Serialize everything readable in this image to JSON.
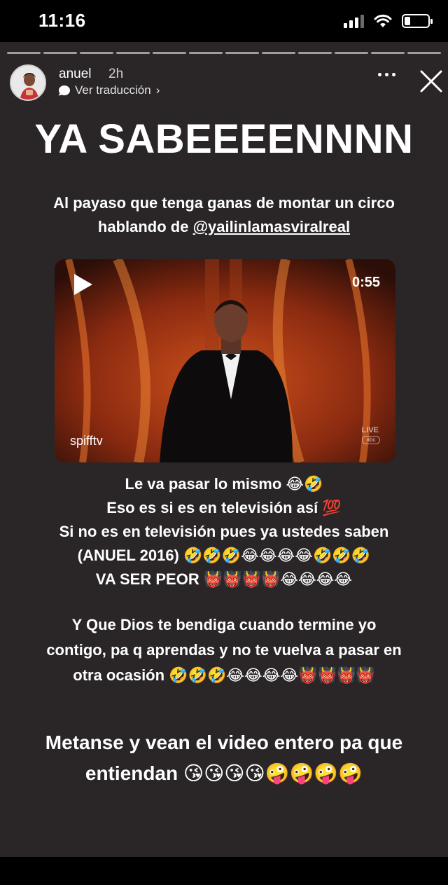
{
  "status_bar": {
    "time": "11:16",
    "signal_bars": 4,
    "signal_bars_filled": 3,
    "battery_level": 0.25
  },
  "story": {
    "background": "#2a2628",
    "progress_segments": 12,
    "header": {
      "username": "anuel",
      "time_ago": "2h",
      "translate_label": "Ver traducción",
      "translate_chevron": "›"
    },
    "title": "YA SABEEEENNNN",
    "intro": {
      "line1": "Al payaso que tenga ganas de montar un circo",
      "line2_prefix": "hablando de ",
      "mention": "@yailinlamasviralreal"
    },
    "video": {
      "duration": "0:55",
      "credit": "spifftv",
      "watermark_live": "LIVE",
      "watermark_network": "abc"
    },
    "block1": {
      "line1": "Le va pasar lo mismo 😂🤣",
      "line2": "Eso es si es en televisión así 💯",
      "line3": "Si no es en televisión pues ya ustedes saben",
      "line4": "(ANUEL 2016) 🤣🤣🤣😂😂😂😂🤣🤣🤣",
      "line5": "VA SER PEOR 👹👹👹👹😂😂😂😂"
    },
    "block2": {
      "line1": "Y Que Dios te bendiga cuando termine yo",
      "line2": "contigo, pa q aprendas y no te vuelva a pasar en",
      "line3": "otra ocasión 🤣🤣🤣😂😂😂😂👹👹👹👹"
    },
    "block3": {
      "line1": "Metanse y vean el video entero pa que",
      "line2": "entiendan 😘😘😘😘🤪🤪🤪🤪"
    }
  },
  "icons": {
    "more": "more-options-icon",
    "close": "close-icon",
    "play": "play-icon",
    "translate": "speech-bubble-icon"
  }
}
